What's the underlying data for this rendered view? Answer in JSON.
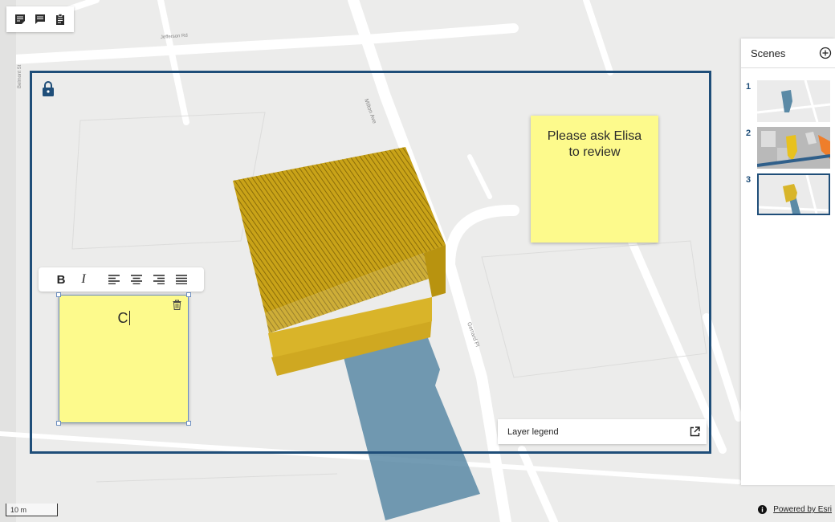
{
  "toolbar": {
    "buttons": [
      {
        "icon": "sticky-note-icon"
      },
      {
        "icon": "comment-icon"
      },
      {
        "icon": "clipboard-icon"
      }
    ]
  },
  "streets": {
    "top_street": "Jefferson Rd",
    "left_street": "Belmont St",
    "diagonal_street": "Milton Ave",
    "right_street": "Gerrard Pl"
  },
  "notes": {
    "review": {
      "line1": "Please ask Elisa",
      "line2": "to review"
    },
    "editing": {
      "text": "C"
    }
  },
  "format_bar": {
    "bold": "B",
    "italic": "I"
  },
  "legend": {
    "label": "Layer legend"
  },
  "scenes": {
    "title": "Scenes",
    "items": [
      {
        "number": "1"
      },
      {
        "number": "2"
      },
      {
        "number": "3",
        "selected": true
      }
    ]
  },
  "scale": {
    "label": "10 m"
  },
  "attribution": {
    "label": "Powered by Esri"
  },
  "colors": {
    "frame": "#1f4e79",
    "note": "#fdfa8c",
    "building": "#d8b52a",
    "shadow": "#5b8aa6"
  }
}
